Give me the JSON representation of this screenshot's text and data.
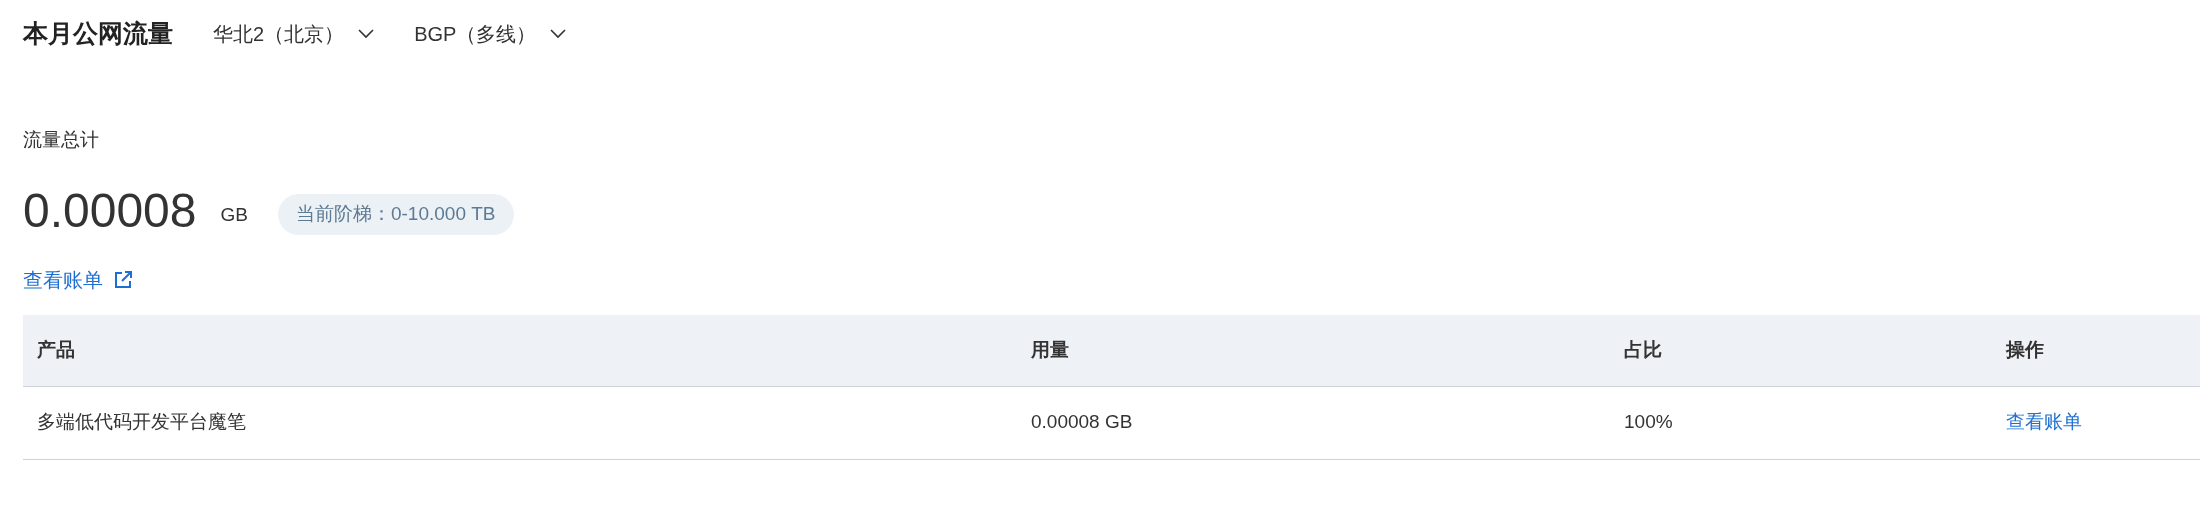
{
  "title": "本月公网流量",
  "dropdowns": [
    {
      "value": "华北2（北京）"
    },
    {
      "value": "BGP（多线）"
    }
  ],
  "total": {
    "label": "流量总计",
    "value": "0.00008",
    "unit": "GB",
    "tier_badge": "当前阶梯：0-10.000 TB"
  },
  "bill_link": "查看账单",
  "table": {
    "columns": [
      "产品",
      "用量",
      "占比",
      "操作"
    ],
    "rows": [
      {
        "product": "多端低代码开发平台魔笔",
        "usage": "0.00008 GB",
        "share": "100%",
        "action": "查看账单"
      }
    ]
  }
}
